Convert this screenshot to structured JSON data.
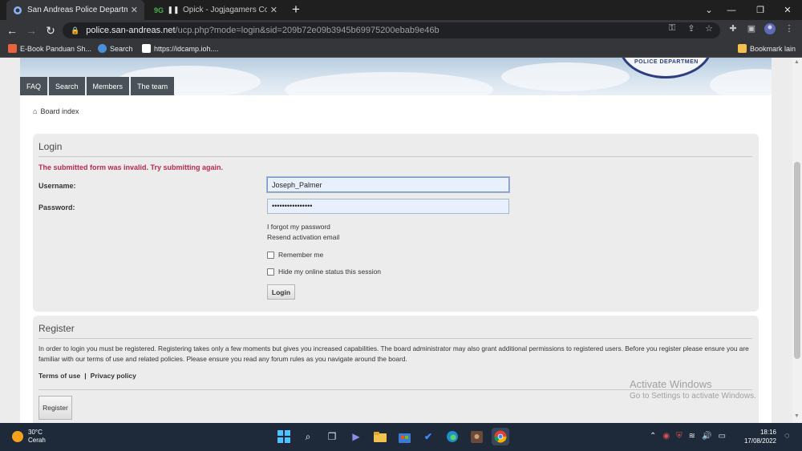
{
  "browser": {
    "tabs": [
      {
        "title": "San Andreas Police Department",
        "active": true
      },
      {
        "title": "Opick - Jogjagamers Commun",
        "active": false
      }
    ],
    "address": {
      "host": "police.san-andreas.net",
      "path": "/ucp.php?mode=login&sid=209b72e09b3945b69975200ebab9e46b"
    },
    "bookmarks": [
      {
        "label": "E-Book Panduan Sh...",
        "color": "#e8643c"
      },
      {
        "label": "Search",
        "color": "#4a90d9"
      },
      {
        "label": "https://idcamp.ioh....",
        "color": "#ffffff"
      }
    ],
    "bookmark_folder": "Bookmark lain"
  },
  "site": {
    "nav_tabs": [
      "FAQ",
      "Search",
      "Members",
      "The team"
    ],
    "seal_text": "POLICE DEPARTMEN",
    "breadcrumb": "Board index"
  },
  "login": {
    "title": "Login",
    "error": "The submitted form was invalid. Try submitting again.",
    "username_label": "Username:",
    "username_value": "Joseph_Palmer",
    "password_label": "Password:",
    "password_mask": "••••••••••••••••",
    "forgot_link": "I forgot my password",
    "resend_link": "Resend activation email",
    "remember_label": "Remember me",
    "hide_label": "Hide my online status this session",
    "login_button": "Login"
  },
  "register": {
    "title": "Register",
    "text": "In order to login you must be registered. Registering takes only a few moments but gives you increased capabilities. The board administrator may also grant additional permissions to registered users. Before you register please ensure you are familiar with our terms of use and related policies. Please ensure you read any forum rules as you navigate around the board.",
    "terms_link": "Terms of use",
    "separator": "|",
    "privacy_link": "Privacy policy",
    "register_button": "Register"
  },
  "watermark": {
    "line1": "Activate Windows",
    "line2": "Go to Settings to activate Windows."
  },
  "taskbar": {
    "weather_temp": "30°C",
    "weather_desc": "Cerah",
    "time": "18:16",
    "date": "17/08/2022"
  },
  "colors": {
    "error": "#bc2a4d",
    "nav_tab_bg": "#4a5158",
    "panel_bg": "#ececec"
  }
}
